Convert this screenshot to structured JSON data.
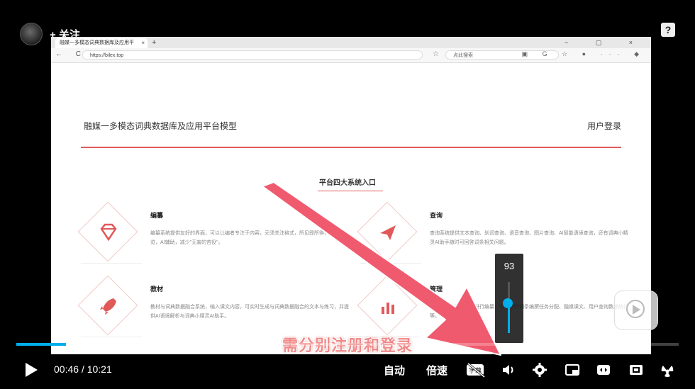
{
  "header": {
    "follow_label": "+ 关注",
    "help_label": "?"
  },
  "browser": {
    "tab_title": "融媒一多模态词典数据库及应用平",
    "tab_close": "×",
    "new_tab": "+",
    "window_controls": "− ▢ ×",
    "nav_icons": "← C",
    "url": "https://bilex.top",
    "star": "☆",
    "search_placeholder": "点此搜索",
    "ext_icons": "▣ G ☆ ● ··· ◆"
  },
  "site": {
    "title": "融媒一多模态词典数据库及应用平台模型",
    "login": "用户登录",
    "section_title": "平台四大系统入口",
    "cards": [
      {
        "title": "编纂",
        "desc": "编纂系统提供友好的界面，可以让编者专注于内容，无须关注格式，所见即所得，实时预览，AI辅助，减少\"无害的苦役\"。"
      },
      {
        "title": "查询",
        "desc": "查询系统提供文本查询、划词查询、语音查询、图片查询、AI智能语境查询，还有词典小精灵AI助手随时可回答词条相关问题。"
      },
      {
        "title": "教材",
        "desc": "教材与词典数据融合系统，输入课文内容，可实时生成与词典数据融合的文本与练习，并提供AI语境解析与词典小精灵AI助手。"
      },
      {
        "title": "管理",
        "desc": "管理系统方便管理员进行编纂，可以进行词条编撰任务分配、融媒课文、用户查询数据统计等。"
      }
    ]
  },
  "volume": {
    "level": 93
  },
  "subtitle": "需分别注册和登录",
  "progress": {
    "played_fraction": 0.075,
    "buffered_fraction": 0.2
  },
  "controls": {
    "current_time": "00:46",
    "separator": "/",
    "duration": "10:21",
    "auto_label": "自动",
    "speed_label": "倍速",
    "subtitle_icon_text": "字幕"
  },
  "colors": {
    "accent": "#00aeec",
    "brand_red": "#e05a5a"
  }
}
